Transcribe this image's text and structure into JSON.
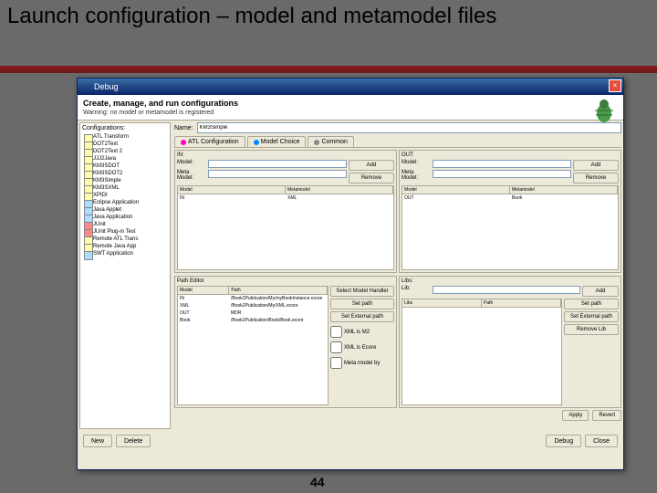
{
  "slide": {
    "title": "Launch configuration – model and metamodel files",
    "page": "44"
  },
  "dialog": {
    "title": "Debug",
    "header": "Create, manage, and run configurations",
    "warning": "Warning: no model or metamodel is registered",
    "close": "×"
  },
  "sidebar": {
    "label": "Configurations:",
    "items": [
      "ATL Transform",
      "DOT2Text",
      "DOT2Text 2",
      "JJJ2Java",
      "KM3SDOT",
      "KM3SDOT2",
      "KM3Simple",
      "KM3SXML",
      "XPIDI"
    ],
    "items2": [
      "Eclipse Application",
      "Java Applet",
      "Java Application",
      "JUnit",
      "JUnit Plug-in Test",
      "Remote ATL Trans",
      "Remote Java App",
      "SWT Application"
    ]
  },
  "form": {
    "name_label": "Name:",
    "name_value": "KM3Simple",
    "tabs": [
      "ATL Configuration",
      "Model Choice",
      "Common"
    ]
  },
  "in_panel": {
    "title": "IN:",
    "model": "Model:",
    "metamodel": "Meta Model:",
    "add": "Add",
    "remove": "Remove",
    "cols": [
      "Model",
      "Metamodel"
    ],
    "rows": [
      [
        "IN",
        "XML"
      ]
    ]
  },
  "out_panel": {
    "title": "OUT:",
    "model": "Model:",
    "metamodel": "Meta Model:",
    "add": "Add",
    "remove": "Remove",
    "cols": [
      "Model",
      "Metamodel"
    ],
    "rows": [
      [
        "OUT",
        "Book"
      ]
    ]
  },
  "path_panel": {
    "title": "Path Editor",
    "cols": [
      "Model",
      "Path"
    ],
    "rows": [
      [
        "IN",
        "/Book2Publication/My/myBookInstance.ecore"
      ],
      [
        "XML",
        "/Book2Publication/My/XML.ecore"
      ],
      [
        "OUT",
        "MDR"
      ],
      [
        "Book",
        "/Book2Publication/Book/Book.ecore"
      ]
    ],
    "btns": [
      "Select Model Handler",
      "Set path",
      "Set External path"
    ],
    "cb1": "XML is M2",
    "cb2": "XML is Ecore",
    "cb3": "Meta model by"
  },
  "lib_panel": {
    "title": "Libs:",
    "lib": "Lib:",
    "add": "Add",
    "cols": [
      "Libs",
      "Path"
    ],
    "btns": [
      "Set path",
      "Set External path",
      "Remove Lib"
    ]
  },
  "ar": {
    "apply": "Apply",
    "revert": "Revert"
  },
  "footer": {
    "new": "New",
    "delete": "Delete",
    "debug": "Debug",
    "close": "Close"
  }
}
